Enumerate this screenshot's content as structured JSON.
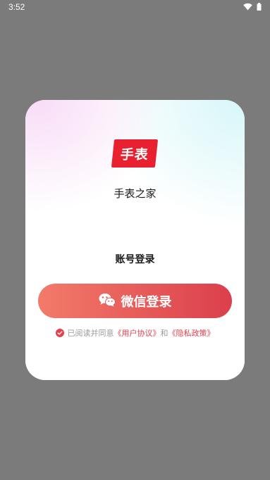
{
  "status_bar": {
    "time": "3:52",
    "icons": [
      "wifi-icon",
      "battery-icon"
    ]
  },
  "dialog": {
    "logo_text": "手表",
    "app_name": "手表之家",
    "account_login_label": "账号登录",
    "wechat_login_label": "微信登录",
    "agreement": {
      "checked": true,
      "prefix": "已阅读并同意",
      "user_agreement": "《用户协议》",
      "and": "和",
      "privacy_policy": "《隐私政策》"
    }
  },
  "colors": {
    "brand_red": "#e8202f",
    "button_gradient_start": "#f37b6a",
    "button_gradient_end": "#db3f4b",
    "link_red": "#e2414d",
    "overlay": "#7b7b7b"
  }
}
